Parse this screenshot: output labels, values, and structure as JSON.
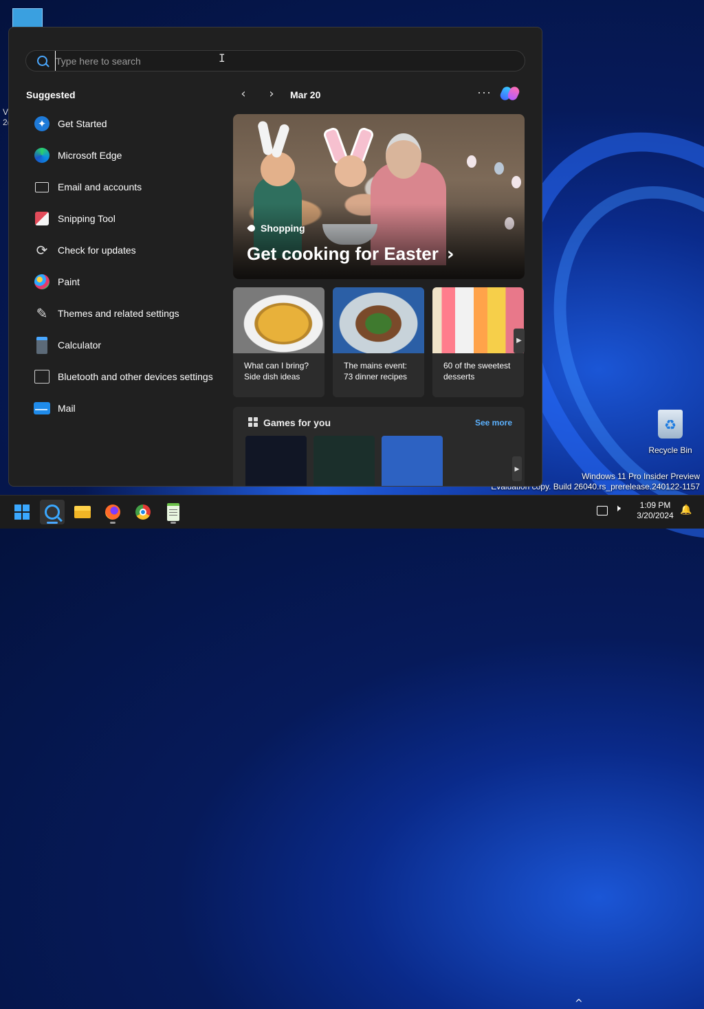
{
  "desktop": {
    "left_text": "V\n2(",
    "recycle_bin": "Recycle Bin",
    "watermark_line1": "Windows 11 Pro Insider Preview",
    "watermark_line2": "Evaluation copy. Build 26040.rs_prerelease.240122-1157"
  },
  "start": {
    "search": {
      "placeholder": "Type here to search",
      "value": ""
    },
    "suggested_title": "Suggested",
    "apps": [
      {
        "label": "Get Started",
        "icon": "get-started-icon"
      },
      {
        "label": "Microsoft Edge",
        "icon": "edge-icon"
      },
      {
        "label": "Email and accounts",
        "icon": "mail-outline-icon"
      },
      {
        "label": "Snipping Tool",
        "icon": "snipping-tool-icon"
      },
      {
        "label": "Check for updates",
        "icon": "refresh-icon"
      },
      {
        "label": "Paint",
        "icon": "paint-icon"
      },
      {
        "label": "Themes and related settings",
        "icon": "brush-icon"
      },
      {
        "label": "Calculator",
        "icon": "calculator-icon"
      },
      {
        "label": "Bluetooth and other devices settings",
        "icon": "devices-icon"
      },
      {
        "label": "Mail",
        "icon": "mail-icon"
      }
    ],
    "news": {
      "date": "Mar 20",
      "more": "···",
      "hero": {
        "tag": "Shopping",
        "title": "Get cooking for Easter",
        "chevron": "›"
      },
      "cards": [
        {
          "line1": "What can I bring?",
          "line2": "Side dish ideas"
        },
        {
          "line1": "The mains event:",
          "line2": "73 dinner recipes"
        },
        {
          "line1": "60 of the sweetest",
          "line2": "desserts"
        }
      ],
      "games": {
        "title": "Games for you",
        "see_more": "See more"
      }
    }
  },
  "taskbar": {
    "items": [
      "start-icon",
      "search-icon",
      "file-explorer-icon",
      "firefox-icon",
      "chrome-icon",
      "notepad-icon"
    ],
    "tray_chevron": "^",
    "time": "1:09 PM",
    "date": "3/20/2024"
  }
}
